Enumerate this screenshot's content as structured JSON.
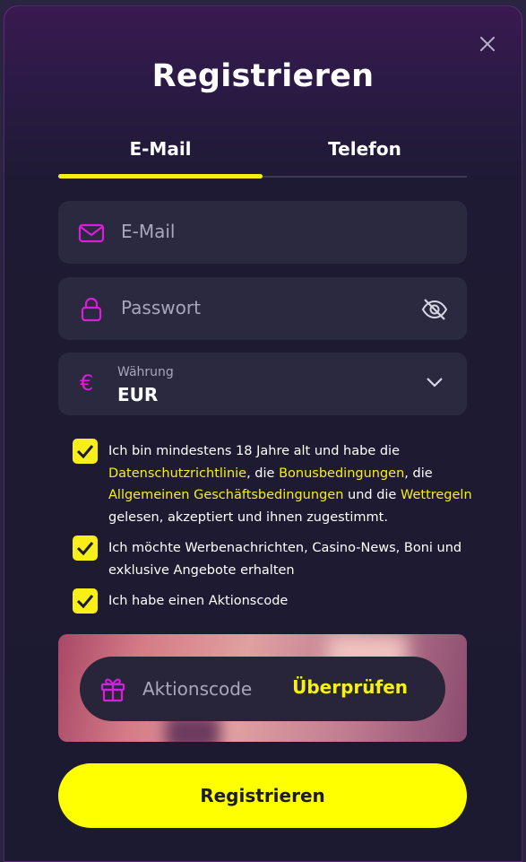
{
  "modal": {
    "title": "Registrieren",
    "tabs": [
      {
        "label": "E-Mail",
        "active": true
      },
      {
        "label": "Telefon",
        "active": false
      }
    ]
  },
  "form": {
    "email": {
      "placeholder": "E-Mail",
      "value": ""
    },
    "password": {
      "placeholder": "Passwort",
      "value": ""
    },
    "currency": {
      "label": "Währung",
      "value": "EUR",
      "icon": "€"
    }
  },
  "consents": [
    {
      "checked": true,
      "parts": [
        {
          "text": "Ich bin mindestens 18 Jahre alt und habe die ",
          "link": false
        },
        {
          "text": "Datenschutzrichtlinie",
          "link": true
        },
        {
          "text": ", die ",
          "link": false
        },
        {
          "text": "Bonusbedingungen",
          "link": true
        },
        {
          "text": ", die ",
          "link": false
        },
        {
          "text": "Allgemeinen Geschäftsbedingungen",
          "link": true
        },
        {
          "text": " und die ",
          "link": false
        },
        {
          "text": "Wettregeln",
          "link": true
        },
        {
          "text": " gelesen, akzeptiert und ihnen zugestimmt.",
          "link": false
        }
      ]
    },
    {
      "checked": true,
      "text": "Ich möchte Werbenachrichten, Casino-News, Boni und exklusive Angebote erhalten"
    },
    {
      "checked": true,
      "text": "Ich habe einen Aktionscode"
    }
  ],
  "promo": {
    "placeholder": "Aktionscode",
    "check_label": "Überprüfen"
  },
  "submit_label": "Registrieren",
  "colors": {
    "accent_yellow": "#f7ef17",
    "icon_magenta": "#d81ed8",
    "field_bg": "#2b2940"
  }
}
